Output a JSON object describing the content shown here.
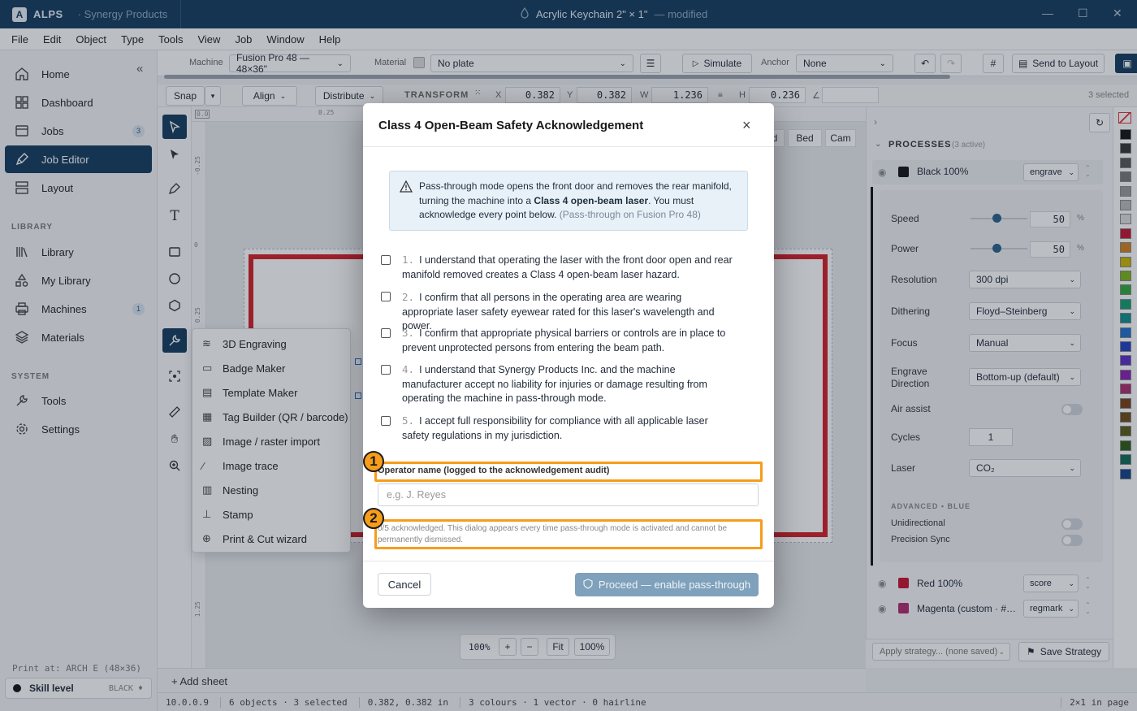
{
  "titlebar": {
    "app_badge": "A",
    "app": "ALPS",
    "org": "· Synergy Products",
    "doc": "Acrylic Keychain 2\" × 1\"",
    "modified": "— modified"
  },
  "menu": [
    "File",
    "Edit",
    "Object",
    "Type",
    "Tools",
    "View",
    "Job",
    "Window",
    "Help"
  ],
  "sidebar": {
    "items": [
      {
        "label": "Home",
        "icon": "home-icon"
      },
      {
        "label": "Dashboard",
        "icon": "dashboard-icon"
      },
      {
        "label": "Jobs",
        "icon": "jobs-icon",
        "badge": "3"
      },
      {
        "label": "Job Editor",
        "icon": "pen-icon",
        "active": true
      },
      {
        "label": "Layout",
        "icon": "layout-icon"
      }
    ],
    "library_label": "LIBRARY",
    "library": [
      {
        "label": "Library",
        "icon": "library-icon"
      },
      {
        "label": "My Library",
        "icon": "shapes-icon"
      },
      {
        "label": "Machines",
        "icon": "printer-icon",
        "badge": "1"
      },
      {
        "label": "Materials",
        "icon": "layers-icon"
      }
    ],
    "system_label": "SYSTEM",
    "system": [
      {
        "label": "Tools",
        "icon": "wrench-icon"
      },
      {
        "label": "Settings",
        "icon": "gear-icon"
      }
    ],
    "print_at": "Print at: ARCH E (48×36)",
    "skill_label": "Skill level",
    "skill_value": "BLACK ♦"
  },
  "toolbar": {
    "machine_label": "Machine",
    "machine_value": "Fusion Pro 48 — 48×36\"",
    "material_label": "Material",
    "material_value": "No plate",
    "simulate": "Simulate",
    "anchor_label": "Anchor",
    "anchor_value": "None",
    "send": "Send to Layout"
  },
  "transform": {
    "snap": "Snap",
    "align": "Align",
    "distribute": "Distribute",
    "label": "TRANSFORM",
    "x": "0.382",
    "y": "0.382",
    "w": "1.236",
    "h": "0.236",
    "selected": "3 selected"
  },
  "ruler": {
    "h1": "0.25",
    "v1": "-0.25",
    "v2": "0",
    "v3": "0.25",
    "v4": "1.25"
  },
  "flyout": [
    {
      "label": "3D Engraving",
      "icon": "stack-icon"
    },
    {
      "label": "Badge Maker",
      "icon": "badge-icon"
    },
    {
      "label": "Template Maker",
      "icon": "template-icon"
    },
    {
      "label": "Tag Builder (QR / barcode)",
      "icon": "qr-icon"
    },
    {
      "label": "Image / raster import",
      "icon": "image-icon"
    },
    {
      "label": "Image trace",
      "icon": "wand-icon"
    },
    {
      "label": "Nesting",
      "icon": "nesting-icon"
    },
    {
      "label": "Stamp",
      "icon": "stamp-icon"
    },
    {
      "label": "Print & Cut wizard",
      "icon": "crosshair-icon"
    }
  ],
  "canvas_tabs": [
    "d",
    "Bed",
    "Cam"
  ],
  "zoom": {
    "level": "100%",
    "plus": "+",
    "minus": "−",
    "fit": "Fit",
    "reset": "100%"
  },
  "add_sheet": "+ Add sheet",
  "processes": {
    "title": "PROCESSES",
    "count": "(3 active)",
    "black": {
      "name": "Black 100%",
      "mode": "engrave",
      "color": "#111111"
    },
    "speed_label": "Speed",
    "speed": "50",
    "power_label": "Power",
    "power": "50",
    "pct": "%",
    "resolution_label": "Resolution",
    "resolution": "300 dpi",
    "dithering_label": "Dithering",
    "dithering": "Floyd–Steinberg",
    "focus_label": "Focus",
    "focus": "Manual",
    "direction_label1": "Engrave",
    "direction_label2": "Direction",
    "direction": "Bottom-up (default)",
    "air_label": "Air assist",
    "air": false,
    "cycles_label": "Cycles",
    "cycles": "1",
    "laser_label": "Laser",
    "laser": "CO₂",
    "advanced": "ADVANCED ▪ BLUE",
    "unidirectional": "Unidirectional",
    "precision": "Precision Sync",
    "red": {
      "name": "Red 100%",
      "mode": "score",
      "color": "#c8102e"
    },
    "magenta": {
      "name": "Magenta (custom · #…",
      "mode": "regmark",
      "color": "#b0286e"
    },
    "strategy": "Apply strategy... (none saved)",
    "save_strategy": "Save Strategy"
  },
  "palette": [
    "#111111",
    "#333333",
    "#555555",
    "#777777",
    "#999999",
    "#bbbbbb",
    "#dddddd",
    "#c8102e",
    "#d4801a",
    "#c9b800",
    "#7cb518",
    "#2fa836",
    "#0e9f6e",
    "#0e8f8f",
    "#1c6fcf",
    "#1f3fc4",
    "#5b2bc9",
    "#8c1fb5",
    "#b0286e",
    "#7a3d12",
    "#6e4a16",
    "#5a5a10",
    "#2f5a12",
    "#0d6b55",
    "#123f8c"
  ],
  "status": {
    "ip": "10.0.0.9",
    "objects": "6 objects · 3 selected",
    "coords": "0.382, 0.382 in",
    "colours": "3 colours · 1 vector · 0 hairline",
    "pages": "2×1 in page"
  },
  "modal": {
    "title": "Class 4 Open-Beam Safety Acknowledgement",
    "close": "×",
    "warn_pre": "Pass-through mode opens the front door and removes the rear manifold, turning the machine into a ",
    "warn_bold": "Class 4 open-beam laser",
    "warn_post": ". You must acknowledge every point below. ",
    "warn_note": "(Pass-through on Fusion Pro 48)",
    "items": [
      {
        "num": "1.",
        "text": "I understand that operating the laser with the front door open and rear manifold removed creates a Class 4 open-beam laser hazard."
      },
      {
        "num": "2.",
        "text": "I confirm that all persons in the operating area are wearing appropriate laser safety eyewear rated for this laser's wavelength and power."
      },
      {
        "num": "3.",
        "text": "I confirm that appropriate physical barriers or controls are in place to prevent unprotected persons from entering the beam path."
      },
      {
        "num": "4.",
        "text": "I understand that Synergy Products Inc. and the machine manufacturer accept no liability for injuries or damage resulting from operating the machine in pass-through mode."
      },
      {
        "num": "5.",
        "text": "I accept full responsibility for compliance with all applicable laser safety regulations in my jurisdiction."
      }
    ],
    "operator_label": "Operator name (logged to the acknowledgement audit)",
    "operator_placeholder": "e.g. J. Reyes",
    "footnote": "0/5 acknowledged. This dialog appears every time pass-through mode is activated and cannot be permanently dismissed.",
    "cancel": "Cancel",
    "proceed": "Proceed — enable pass-through"
  },
  "callouts": [
    "1",
    "2"
  ]
}
